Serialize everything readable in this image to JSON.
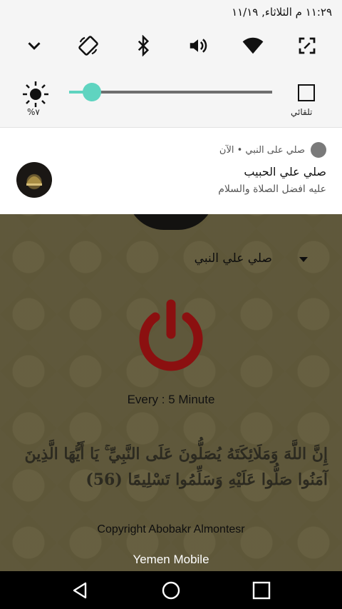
{
  "status_bar": {
    "time_date": "١١:٢٩ م الثلاثاء, ١١/١٩"
  },
  "quick_settings": {
    "icons": [
      "chevron-down-icon",
      "auto-rotate-icon",
      "bluetooth-icon",
      "volume-icon",
      "wifi-icon",
      "screen-expand-icon"
    ]
  },
  "brightness": {
    "percent_label": "%٧",
    "level": 0.07,
    "auto_label": "تلقائي"
  },
  "notification": {
    "app_name": "صلي على النبي • الآن",
    "title": "صلي علي الحبيب",
    "text": "عليه افضل الصلاة والسلام"
  },
  "app": {
    "dropdown_value": "صلي علي النبي",
    "interval_text": "Every : 5 Minute",
    "verse": "إِنَّ اللَّهَ وَمَلَائِكَتَهُ يُصَلُّونَ عَلَى النَّبِيِّ ۚ يَا أَيُّهَا الَّذِينَ آمَنُوا صَلُّوا عَلَيْهِ وَسَلِّمُوا تَسْلِيمًا (56)",
    "copyright": "Copyright Abobakr Almontesr",
    "carrier": "Yemen Mobile"
  },
  "colors": {
    "accent": "#5fd4c0",
    "power": "#8b1010"
  }
}
